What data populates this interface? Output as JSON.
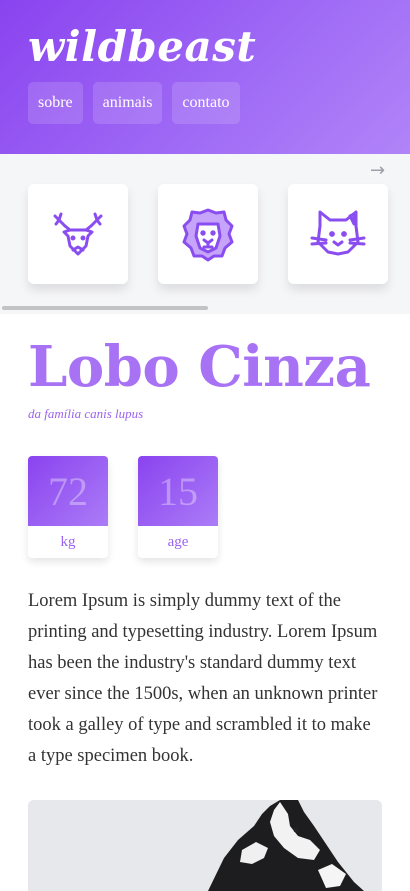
{
  "header": {
    "brand": "wildbeast",
    "nav": [
      "sobre",
      "animais",
      "contato"
    ]
  },
  "carousel": {
    "arrow": "→",
    "cards": [
      {
        "icon": "deer-icon"
      },
      {
        "icon": "lion-icon"
      },
      {
        "icon": "cat-icon"
      }
    ]
  },
  "animal": {
    "name": "Lobo Cinza",
    "family": "da família canis lupus",
    "stats": [
      {
        "value": "72",
        "label": "kg"
      },
      {
        "value": "15",
        "label": "age"
      }
    ],
    "description": "Lorem Ipsum is simply dummy text of the printing and typesetting industry. Lorem Ipsum has been the industry's standard dummy text ever since the 1500s, when an unknown printer took a galley of type and scrambled it to make a type specimen book."
  },
  "colors": {
    "accent": "#8a43ef",
    "accent_light": "#a872f5",
    "icon_stroke": "#8a4df0"
  }
}
